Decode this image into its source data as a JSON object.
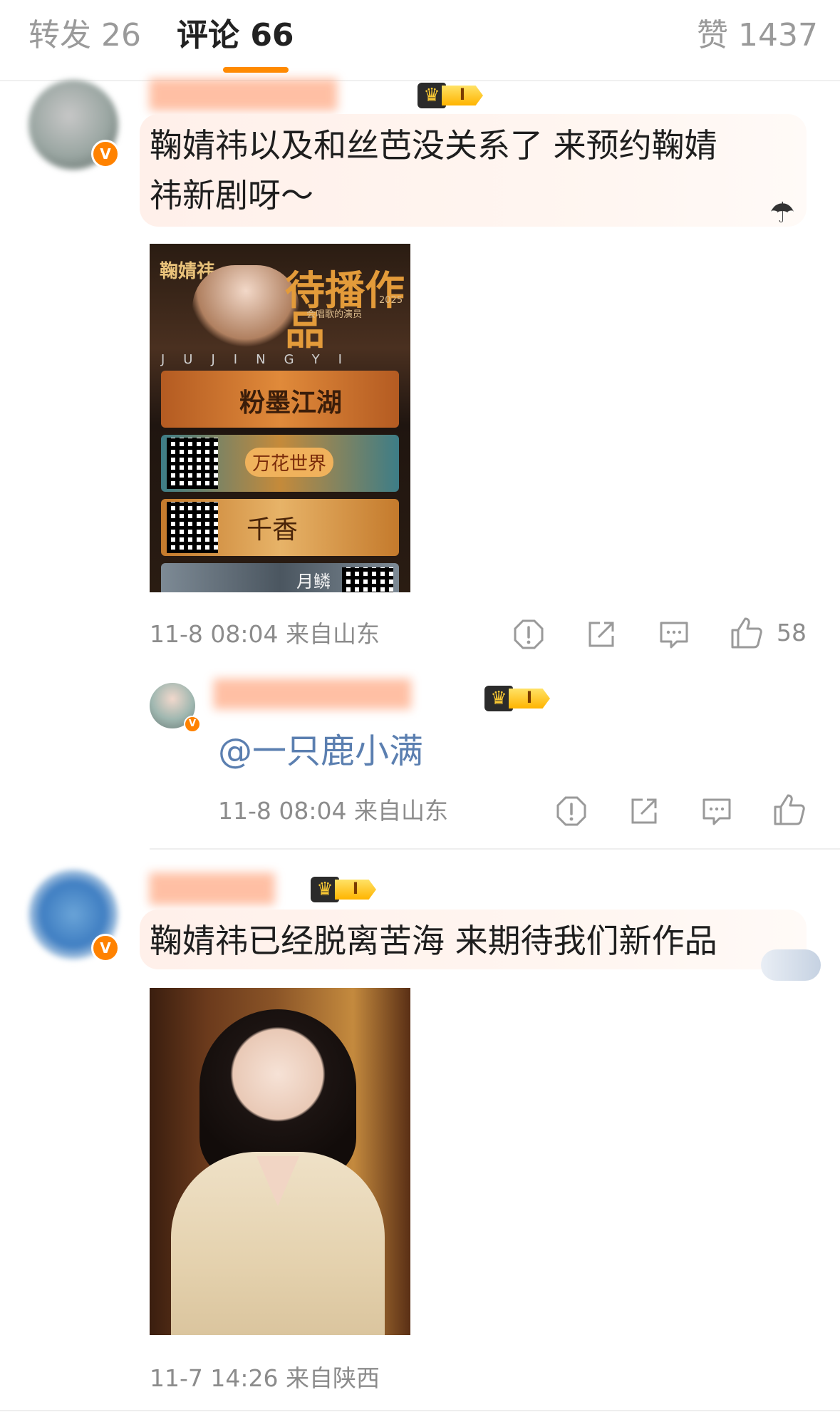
{
  "tabs": {
    "repost": "转发 26",
    "comments": "评论 66",
    "likes": "赞 1437"
  },
  "level_badge": "I",
  "comments": [
    {
      "text_line1": "鞠婧祎以及和丝芭没关系了 来预约鞠婧",
      "text_line2": "祎新剧呀～",
      "meta": "11-8 08:04 来自山东",
      "like_count": "58"
    },
    {
      "mention": "@一只鹿小满",
      "meta": "11-8 08:04 来自山东"
    },
    {
      "text_line1": "鞠婧祎已经脱离苦海 来期待我们新作品",
      "meta": "11-7 14:26 来自陕西"
    }
  ],
  "poster": {
    "name": "鞠婧祎",
    "title": "待播作品",
    "subtitle": "会唱歌的演员",
    "year": "2025",
    "letters": "JUJINGYI",
    "works": [
      "粉墨江湖",
      "万花世界",
      "千香",
      "月鳞"
    ]
  },
  "icons": {
    "report": "report-icon",
    "share": "share-icon",
    "comment": "comment-icon",
    "like": "like-icon",
    "verified": "verified-icon"
  }
}
